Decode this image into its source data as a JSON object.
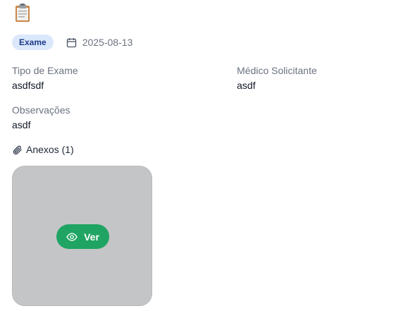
{
  "record": {
    "type_badge": "Exame",
    "date": "2025-08-13"
  },
  "fields": {
    "exam_type": {
      "label": "Tipo de Exame",
      "value": "asdfsdf"
    },
    "requesting_doctor": {
      "label": "Médico Solicitante",
      "value": "asdf"
    },
    "notes": {
      "label": "Observações",
      "value": "asdf"
    }
  },
  "attachments": {
    "header": "Anexos (1)",
    "items": [
      {
        "view_label": "Ver"
      }
    ]
  },
  "icons": {
    "header": "clipboard-icon",
    "date": "calendar-icon",
    "attachments": "paperclip-icon",
    "view": "eye-icon"
  },
  "colors": {
    "badge_bg": "#dbe8fb",
    "badge_text": "#1e3a8a",
    "view_button": "#1fa463",
    "attachment_placeholder": "#c4c5c6"
  }
}
